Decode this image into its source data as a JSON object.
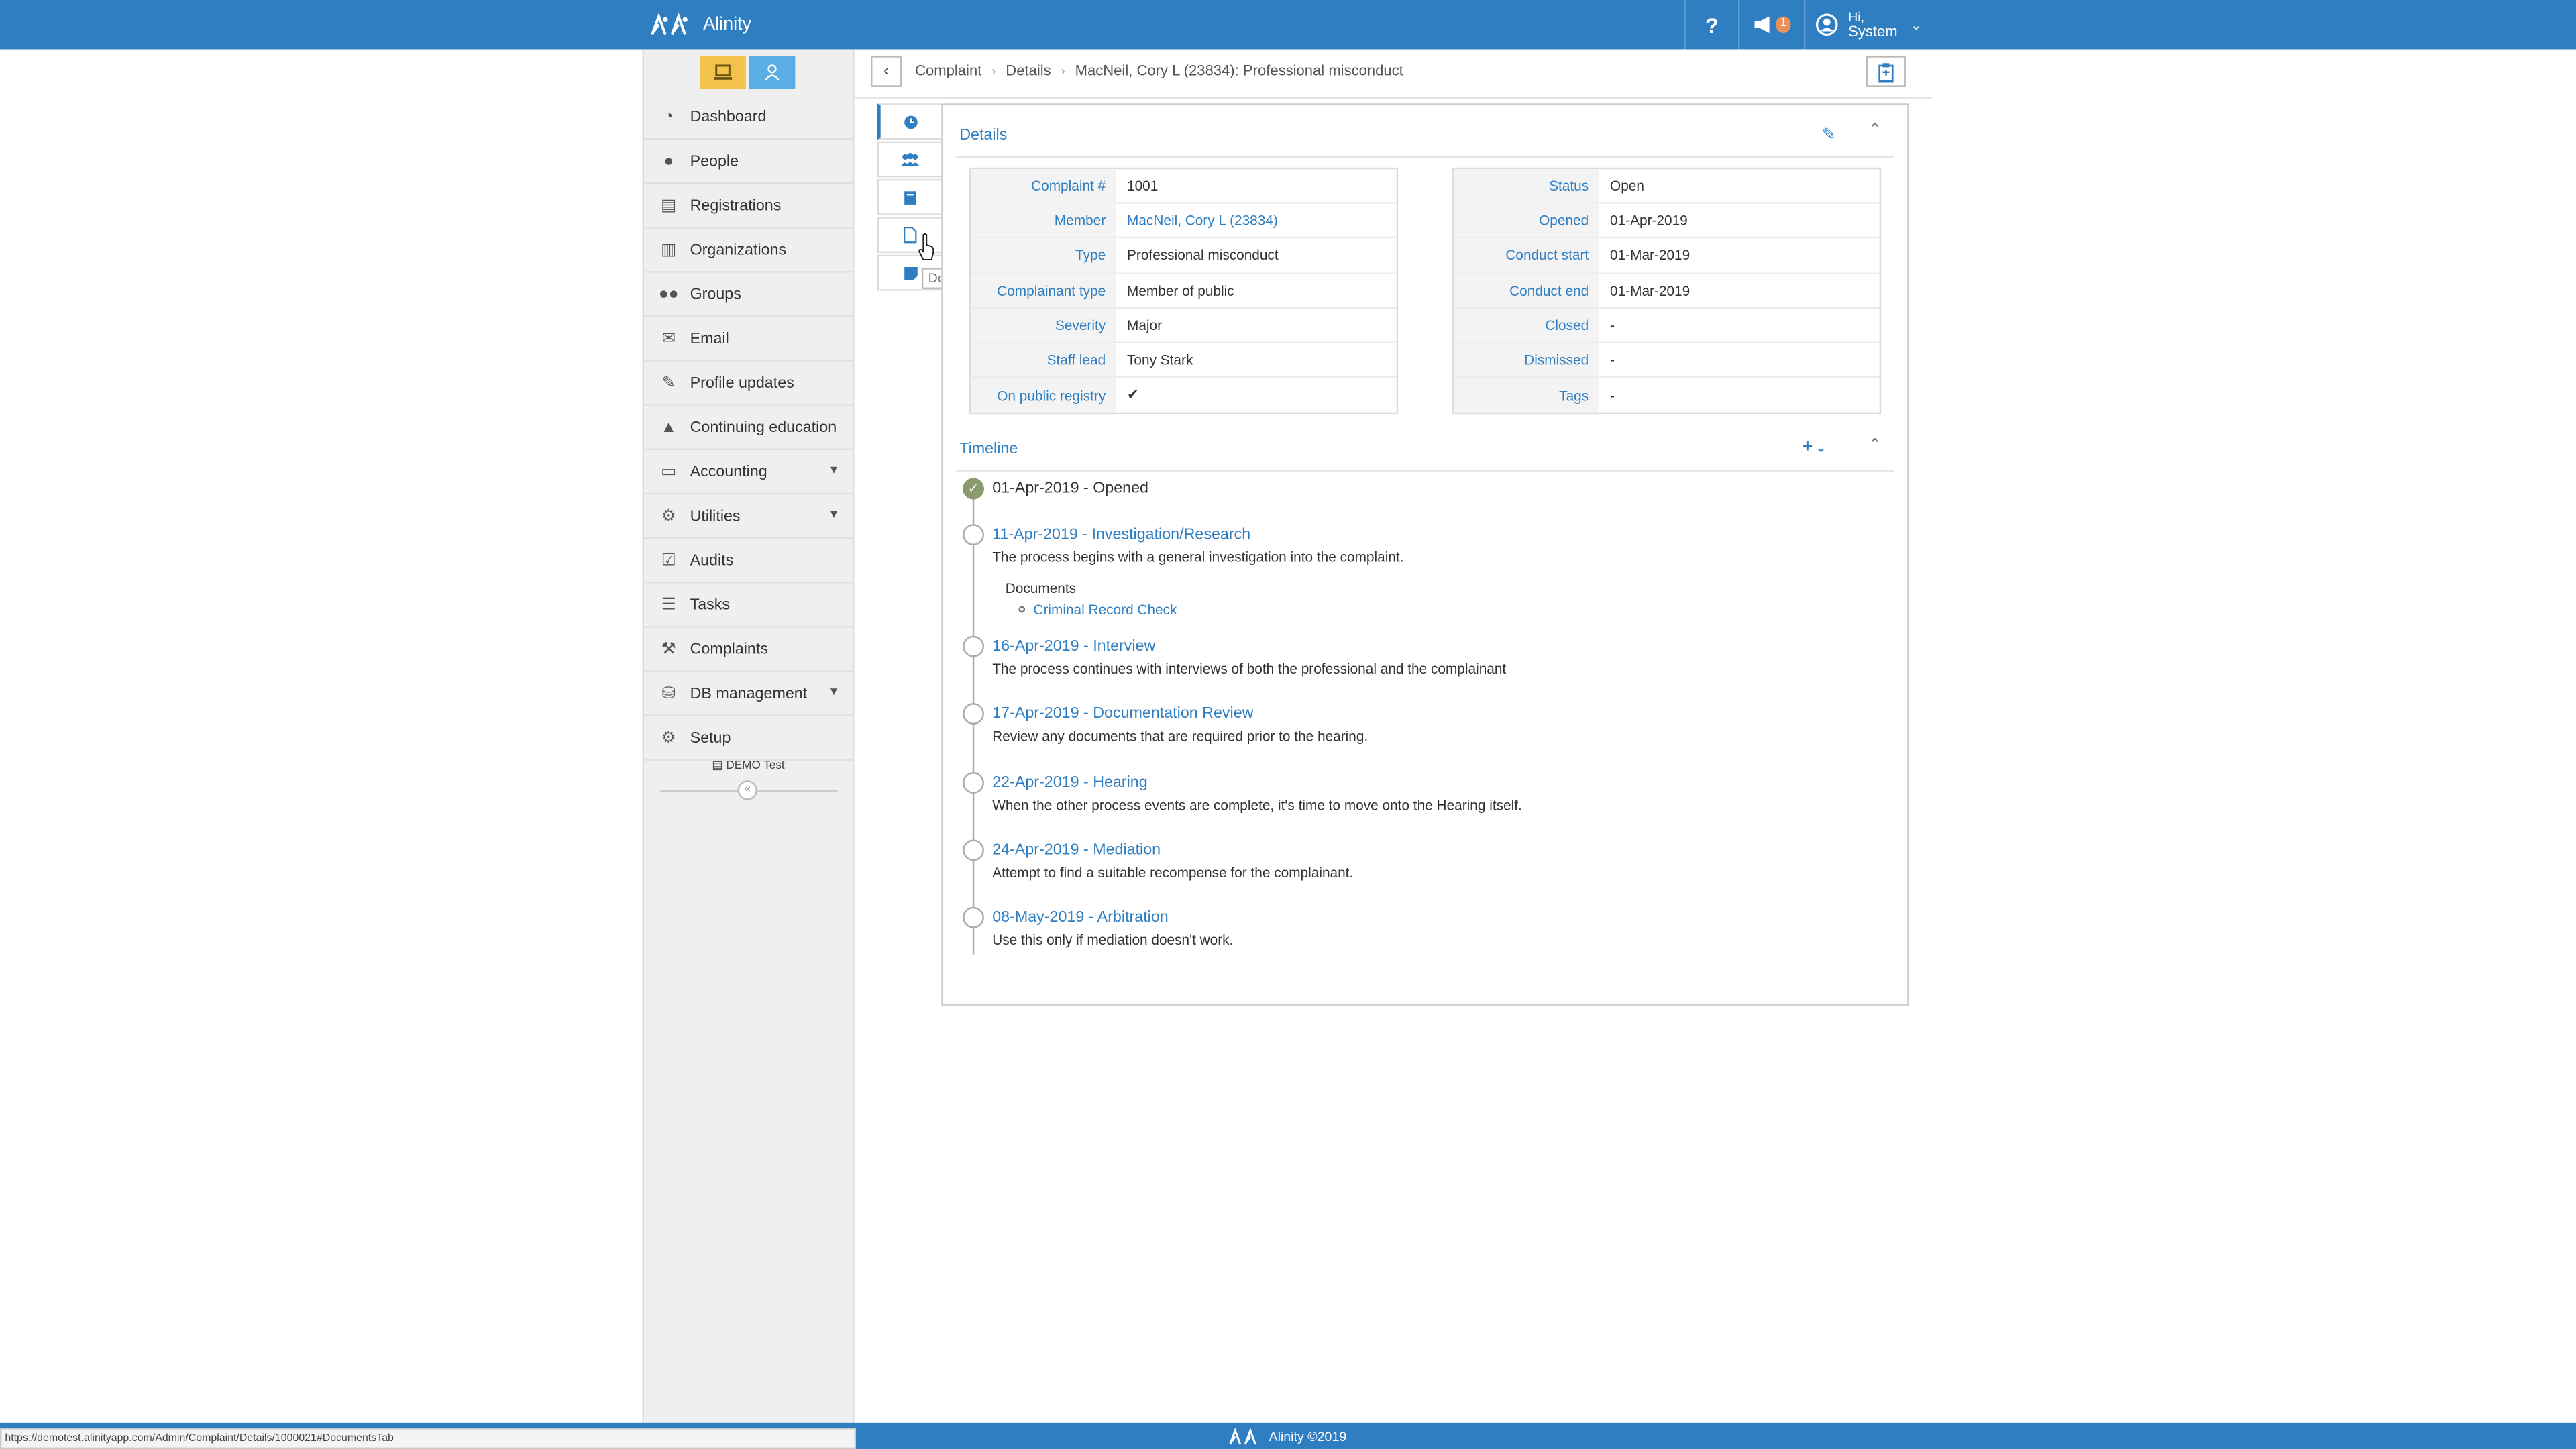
{
  "app": {
    "name": "Alinity"
  },
  "topbar": {
    "help": "?",
    "notif_count": "1",
    "user_greeting": "Hi,",
    "user_name": "System"
  },
  "sidebar": {
    "items": [
      {
        "label": "Dashboard",
        "icon": "dashboard-icon",
        "glyph": "◔"
      },
      {
        "label": "People",
        "icon": "person-icon",
        "glyph": "●"
      },
      {
        "label": "Registrations",
        "icon": "id-card-icon",
        "glyph": "▤"
      },
      {
        "label": "Organizations",
        "icon": "building-icon",
        "glyph": "▥"
      },
      {
        "label": "Groups",
        "icon": "users-icon",
        "glyph": "●●"
      },
      {
        "label": "Email",
        "icon": "envelope-icon",
        "glyph": "✉"
      },
      {
        "label": "Profile updates",
        "icon": "edit-icon",
        "glyph": "✎"
      },
      {
        "label": "Continuing education",
        "icon": "graduation-cap-icon",
        "glyph": "▲"
      },
      {
        "label": "Accounting",
        "icon": "money-icon",
        "glyph": "▭",
        "chevron": true
      },
      {
        "label": "Utilities",
        "icon": "gears-icon",
        "glyph": "⚙",
        "chevron": true
      },
      {
        "label": "Audits",
        "icon": "checkbox-icon",
        "glyph": "☑"
      },
      {
        "label": "Tasks",
        "icon": "list-icon",
        "glyph": "☰"
      },
      {
        "label": "Complaints",
        "icon": "gavel-icon",
        "glyph": "⚒"
      },
      {
        "label": "DB management",
        "icon": "database-icon",
        "glyph": "⛁",
        "chevron": true
      },
      {
        "label": "Setup",
        "icon": "gear-icon",
        "glyph": "⚙"
      }
    ],
    "demo_label": "DEMO Test",
    "collapse": "«"
  },
  "breadcrumb": {
    "items": [
      "Complaint",
      "Details",
      "MacNeil, Cory L (23834): Professional misconduct"
    ]
  },
  "tooltip": "Documents",
  "details": {
    "title": "Details",
    "left": [
      {
        "label": "Complaint #",
        "value": "1001"
      },
      {
        "label": "Member",
        "value": "MacNeil, Cory L (23834)",
        "link": true
      },
      {
        "label": "Type",
        "value": "Professional misconduct"
      },
      {
        "label": "Complainant type",
        "value": "Member of public"
      },
      {
        "label": "Severity",
        "value": "Major"
      },
      {
        "label": "Staff lead",
        "value": "Tony Stark"
      },
      {
        "label": "On public registry",
        "value": "✔"
      }
    ],
    "right": [
      {
        "label": "Status",
        "value": "Open"
      },
      {
        "label": "Opened",
        "value": "01-Apr-2019"
      },
      {
        "label": "Conduct start",
        "value": "01-Mar-2019"
      },
      {
        "label": "Conduct end",
        "value": "01-Mar-2019"
      },
      {
        "label": "Closed",
        "value": "-"
      },
      {
        "label": "Dismissed",
        "value": "-"
      },
      {
        "label": "Tags",
        "value": "-"
      }
    ]
  },
  "timeline": {
    "title": "Timeline",
    "events": [
      {
        "title": "01-Apr-2019 - Opened",
        "desc": "",
        "done": true
      },
      {
        "title": "11-Apr-2019 - Investigation/Research",
        "desc": "The process begins with a general investigation into the complaint."
      },
      {
        "title": "16-Apr-2019 - Interview",
        "desc": "The process continues with interviews of both the professional and the complainant"
      },
      {
        "title": "17-Apr-2019 - Documentation Review",
        "desc": "Review any documents that are required prior to the hearing."
      },
      {
        "title": "22-Apr-2019 - Hearing",
        "desc": "When the other process events are complete, it's time to move onto the Hearing itself."
      },
      {
        "title": "24-Apr-2019 - Mediation",
        "desc": "Attempt to find a suitable recompense for the complainant."
      },
      {
        "title": "08-May-2019 - Arbitration",
        "desc": "Use this only if mediation doesn't work."
      }
    ],
    "documents_label": "Documents",
    "document_link": "Criminal Record Check"
  },
  "footer": {
    "text": "Alinity ©2019"
  },
  "status_url": "https://demotest.alinityapp.com/Admin/Complaint/Details/1000021#DocumentsTab"
}
